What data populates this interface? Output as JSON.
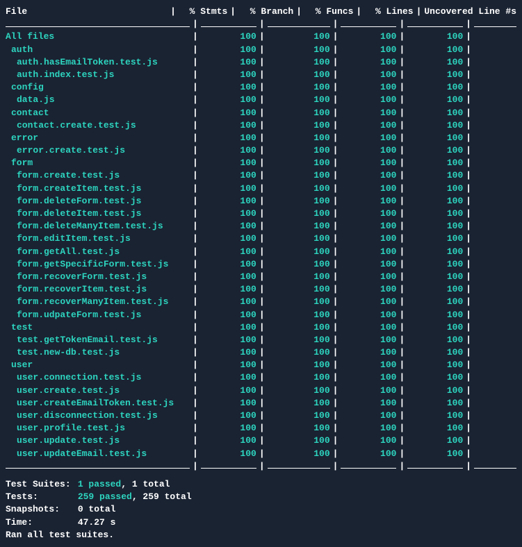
{
  "headers": {
    "file": "File",
    "stmts": "% Stmts",
    "branch": "% Branch",
    "funcs": "% Funcs",
    "lines": "% Lines",
    "uncovered": "Uncovered Line #s"
  },
  "rows": [
    {
      "name": "All files",
      "indent": 0,
      "stmts": "100",
      "branch": "100",
      "funcs": "100",
      "lines": "100"
    },
    {
      "name": "auth",
      "indent": 1,
      "stmts": "100",
      "branch": "100",
      "funcs": "100",
      "lines": "100"
    },
    {
      "name": "auth.hasEmailToken.test.js",
      "indent": 2,
      "stmts": "100",
      "branch": "100",
      "funcs": "100",
      "lines": "100"
    },
    {
      "name": "auth.index.test.js",
      "indent": 2,
      "stmts": "100",
      "branch": "100",
      "funcs": "100",
      "lines": "100"
    },
    {
      "name": "config",
      "indent": 1,
      "stmts": "100",
      "branch": "100",
      "funcs": "100",
      "lines": "100"
    },
    {
      "name": "data.js",
      "indent": 2,
      "stmts": "100",
      "branch": "100",
      "funcs": "100",
      "lines": "100"
    },
    {
      "name": "contact",
      "indent": 1,
      "stmts": "100",
      "branch": "100",
      "funcs": "100",
      "lines": "100"
    },
    {
      "name": "contact.create.test.js",
      "indent": 2,
      "stmts": "100",
      "branch": "100",
      "funcs": "100",
      "lines": "100"
    },
    {
      "name": "error",
      "indent": 1,
      "stmts": "100",
      "branch": "100",
      "funcs": "100",
      "lines": "100"
    },
    {
      "name": "error.create.test.js",
      "indent": 2,
      "stmts": "100",
      "branch": "100",
      "funcs": "100",
      "lines": "100"
    },
    {
      "name": "form",
      "indent": 1,
      "stmts": "100",
      "branch": "100",
      "funcs": "100",
      "lines": "100"
    },
    {
      "name": "form.create.test.js",
      "indent": 2,
      "stmts": "100",
      "branch": "100",
      "funcs": "100",
      "lines": "100"
    },
    {
      "name": "form.createItem.test.js",
      "indent": 2,
      "stmts": "100",
      "branch": "100",
      "funcs": "100",
      "lines": "100"
    },
    {
      "name": "form.deleteForm.test.js",
      "indent": 2,
      "stmts": "100",
      "branch": "100",
      "funcs": "100",
      "lines": "100"
    },
    {
      "name": "form.deleteItem.test.js",
      "indent": 2,
      "stmts": "100",
      "branch": "100",
      "funcs": "100",
      "lines": "100"
    },
    {
      "name": "form.deleteManyItem.test.js",
      "indent": 2,
      "stmts": "100",
      "branch": "100",
      "funcs": "100",
      "lines": "100"
    },
    {
      "name": "form.editItem.test.js",
      "indent": 2,
      "stmts": "100",
      "branch": "100",
      "funcs": "100",
      "lines": "100"
    },
    {
      "name": "form.getAll.test.js",
      "indent": 2,
      "stmts": "100",
      "branch": "100",
      "funcs": "100",
      "lines": "100"
    },
    {
      "name": "form.getSpecificForm.test.js",
      "indent": 2,
      "stmts": "100",
      "branch": "100",
      "funcs": "100",
      "lines": "100"
    },
    {
      "name": "form.recoverForm.test.js",
      "indent": 2,
      "stmts": "100",
      "branch": "100",
      "funcs": "100",
      "lines": "100"
    },
    {
      "name": "form.recoverItem.test.js",
      "indent": 2,
      "stmts": "100",
      "branch": "100",
      "funcs": "100",
      "lines": "100"
    },
    {
      "name": "form.recoverManyItem.test.js",
      "indent": 2,
      "stmts": "100",
      "branch": "100",
      "funcs": "100",
      "lines": "100"
    },
    {
      "name": "form.udpateForm.test.js",
      "indent": 2,
      "stmts": "100",
      "branch": "100",
      "funcs": "100",
      "lines": "100"
    },
    {
      "name": "test",
      "indent": 1,
      "stmts": "100",
      "branch": "100",
      "funcs": "100",
      "lines": "100"
    },
    {
      "name": "test.getTokenEmail.test.js",
      "indent": 2,
      "stmts": "100",
      "branch": "100",
      "funcs": "100",
      "lines": "100"
    },
    {
      "name": "test.new-db.test.js",
      "indent": 2,
      "stmts": "100",
      "branch": "100",
      "funcs": "100",
      "lines": "100"
    },
    {
      "name": "user",
      "indent": 1,
      "stmts": "100",
      "branch": "100",
      "funcs": "100",
      "lines": "100"
    },
    {
      "name": "user.connection.test.js",
      "indent": 2,
      "stmts": "100",
      "branch": "100",
      "funcs": "100",
      "lines": "100"
    },
    {
      "name": "user.create.test.js",
      "indent": 2,
      "stmts": "100",
      "branch": "100",
      "funcs": "100",
      "lines": "100"
    },
    {
      "name": "user.createEmailToken.test.js",
      "indent": 2,
      "stmts": "100",
      "branch": "100",
      "funcs": "100",
      "lines": "100"
    },
    {
      "name": "user.disconnection.test.js",
      "indent": 2,
      "stmts": "100",
      "branch": "100",
      "funcs": "100",
      "lines": "100"
    },
    {
      "name": "user.profile.test.js",
      "indent": 2,
      "stmts": "100",
      "branch": "100",
      "funcs": "100",
      "lines": "100"
    },
    {
      "name": "user.update.test.js",
      "indent": 2,
      "stmts": "100",
      "branch": "100",
      "funcs": "100",
      "lines": "100"
    },
    {
      "name": "user.updateEmail.test.js",
      "indent": 2,
      "stmts": "100",
      "branch": "100",
      "funcs": "100",
      "lines": "100"
    }
  ],
  "summary": {
    "testSuites": {
      "label": "Test Suites:",
      "passed": "1 passed",
      "total": ", 1 total"
    },
    "tests": {
      "label": "Tests:",
      "passed": "259 passed",
      "total": ", 259 total"
    },
    "snapshots": {
      "label": "Snapshots:",
      "value": "0 total"
    },
    "time": {
      "label": "Time:",
      "value": "47.27 s"
    },
    "final": "Ran all test suites."
  }
}
